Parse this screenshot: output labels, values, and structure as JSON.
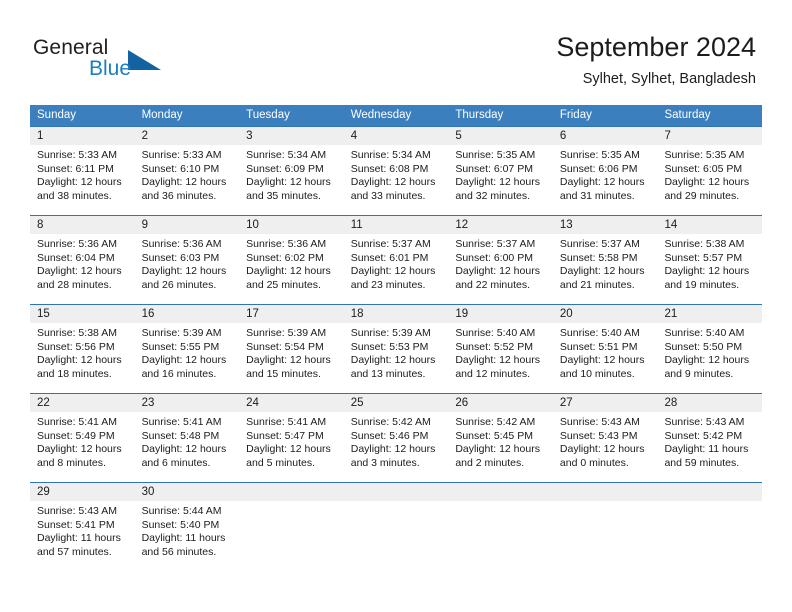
{
  "brand": {
    "name_part1": "General",
    "name_part2": "Blue",
    "flag_icon": "blue-flag-icon"
  },
  "header": {
    "title": "September 2024",
    "location": "Sylhet, Sylhet, Bangladesh"
  },
  "colors": {
    "header_blue": "#3c7fbf",
    "rule_blue": "#2f74b5",
    "daynum_band": "#efefef",
    "brand_blue": "#1a7fc1",
    "text": "#1c1c1c"
  },
  "weekdays": [
    "Sunday",
    "Monday",
    "Tuesday",
    "Wednesday",
    "Thursday",
    "Friday",
    "Saturday"
  ],
  "weeks": [
    [
      {
        "day": "1",
        "sunrise": "Sunrise: 5:33 AM",
        "sunset": "Sunset: 6:11 PM",
        "daylight1": "Daylight: 12 hours",
        "daylight2": "and 38 minutes."
      },
      {
        "day": "2",
        "sunrise": "Sunrise: 5:33 AM",
        "sunset": "Sunset: 6:10 PM",
        "daylight1": "Daylight: 12 hours",
        "daylight2": "and 36 minutes."
      },
      {
        "day": "3",
        "sunrise": "Sunrise: 5:34 AM",
        "sunset": "Sunset: 6:09 PM",
        "daylight1": "Daylight: 12 hours",
        "daylight2": "and 35 minutes."
      },
      {
        "day": "4",
        "sunrise": "Sunrise: 5:34 AM",
        "sunset": "Sunset: 6:08 PM",
        "daylight1": "Daylight: 12 hours",
        "daylight2": "and 33 minutes."
      },
      {
        "day": "5",
        "sunrise": "Sunrise: 5:35 AM",
        "sunset": "Sunset: 6:07 PM",
        "daylight1": "Daylight: 12 hours",
        "daylight2": "and 32 minutes."
      },
      {
        "day": "6",
        "sunrise": "Sunrise: 5:35 AM",
        "sunset": "Sunset: 6:06 PM",
        "daylight1": "Daylight: 12 hours",
        "daylight2": "and 31 minutes."
      },
      {
        "day": "7",
        "sunrise": "Sunrise: 5:35 AM",
        "sunset": "Sunset: 6:05 PM",
        "daylight1": "Daylight: 12 hours",
        "daylight2": "and 29 minutes."
      }
    ],
    [
      {
        "day": "8",
        "sunrise": "Sunrise: 5:36 AM",
        "sunset": "Sunset: 6:04 PM",
        "daylight1": "Daylight: 12 hours",
        "daylight2": "and 28 minutes."
      },
      {
        "day": "9",
        "sunrise": "Sunrise: 5:36 AM",
        "sunset": "Sunset: 6:03 PM",
        "daylight1": "Daylight: 12 hours",
        "daylight2": "and 26 minutes."
      },
      {
        "day": "10",
        "sunrise": "Sunrise: 5:36 AM",
        "sunset": "Sunset: 6:02 PM",
        "daylight1": "Daylight: 12 hours",
        "daylight2": "and 25 minutes."
      },
      {
        "day": "11",
        "sunrise": "Sunrise: 5:37 AM",
        "sunset": "Sunset: 6:01 PM",
        "daylight1": "Daylight: 12 hours",
        "daylight2": "and 23 minutes."
      },
      {
        "day": "12",
        "sunrise": "Sunrise: 5:37 AM",
        "sunset": "Sunset: 6:00 PM",
        "daylight1": "Daylight: 12 hours",
        "daylight2": "and 22 minutes."
      },
      {
        "day": "13",
        "sunrise": "Sunrise: 5:37 AM",
        "sunset": "Sunset: 5:58 PM",
        "daylight1": "Daylight: 12 hours",
        "daylight2": "and 21 minutes."
      },
      {
        "day": "14",
        "sunrise": "Sunrise: 5:38 AM",
        "sunset": "Sunset: 5:57 PM",
        "daylight1": "Daylight: 12 hours",
        "daylight2": "and 19 minutes."
      }
    ],
    [
      {
        "day": "15",
        "sunrise": "Sunrise: 5:38 AM",
        "sunset": "Sunset: 5:56 PM",
        "daylight1": "Daylight: 12 hours",
        "daylight2": "and 18 minutes."
      },
      {
        "day": "16",
        "sunrise": "Sunrise: 5:39 AM",
        "sunset": "Sunset: 5:55 PM",
        "daylight1": "Daylight: 12 hours",
        "daylight2": "and 16 minutes."
      },
      {
        "day": "17",
        "sunrise": "Sunrise: 5:39 AM",
        "sunset": "Sunset: 5:54 PM",
        "daylight1": "Daylight: 12 hours",
        "daylight2": "and 15 minutes."
      },
      {
        "day": "18",
        "sunrise": "Sunrise: 5:39 AM",
        "sunset": "Sunset: 5:53 PM",
        "daylight1": "Daylight: 12 hours",
        "daylight2": "and 13 minutes."
      },
      {
        "day": "19",
        "sunrise": "Sunrise: 5:40 AM",
        "sunset": "Sunset: 5:52 PM",
        "daylight1": "Daylight: 12 hours",
        "daylight2": "and 12 minutes."
      },
      {
        "day": "20",
        "sunrise": "Sunrise: 5:40 AM",
        "sunset": "Sunset: 5:51 PM",
        "daylight1": "Daylight: 12 hours",
        "daylight2": "and 10 minutes."
      },
      {
        "day": "21",
        "sunrise": "Sunrise: 5:40 AM",
        "sunset": "Sunset: 5:50 PM",
        "daylight1": "Daylight: 12 hours",
        "daylight2": "and 9 minutes."
      }
    ],
    [
      {
        "day": "22",
        "sunrise": "Sunrise: 5:41 AM",
        "sunset": "Sunset: 5:49 PM",
        "daylight1": "Daylight: 12 hours",
        "daylight2": "and 8 minutes."
      },
      {
        "day": "23",
        "sunrise": "Sunrise: 5:41 AM",
        "sunset": "Sunset: 5:48 PM",
        "daylight1": "Daylight: 12 hours",
        "daylight2": "and 6 minutes."
      },
      {
        "day": "24",
        "sunrise": "Sunrise: 5:41 AM",
        "sunset": "Sunset: 5:47 PM",
        "daylight1": "Daylight: 12 hours",
        "daylight2": "and 5 minutes."
      },
      {
        "day": "25",
        "sunrise": "Sunrise: 5:42 AM",
        "sunset": "Sunset: 5:46 PM",
        "daylight1": "Daylight: 12 hours",
        "daylight2": "and 3 minutes."
      },
      {
        "day": "26",
        "sunrise": "Sunrise: 5:42 AM",
        "sunset": "Sunset: 5:45 PM",
        "daylight1": "Daylight: 12 hours",
        "daylight2": "and 2 minutes."
      },
      {
        "day": "27",
        "sunrise": "Sunrise: 5:43 AM",
        "sunset": "Sunset: 5:43 PM",
        "daylight1": "Daylight: 12 hours",
        "daylight2": "and 0 minutes."
      },
      {
        "day": "28",
        "sunrise": "Sunrise: 5:43 AM",
        "sunset": "Sunset: 5:42 PM",
        "daylight1": "Daylight: 11 hours",
        "daylight2": "and 59 minutes."
      }
    ],
    [
      {
        "day": "29",
        "sunrise": "Sunrise: 5:43 AM",
        "sunset": "Sunset: 5:41 PM",
        "daylight1": "Daylight: 11 hours",
        "daylight2": "and 57 minutes."
      },
      {
        "day": "30",
        "sunrise": "Sunrise: 5:44 AM",
        "sunset": "Sunset: 5:40 PM",
        "daylight1": "Daylight: 11 hours",
        "daylight2": "and 56 minutes."
      },
      {
        "day": "",
        "sunrise": "",
        "sunset": "",
        "daylight1": "",
        "daylight2": ""
      },
      {
        "day": "",
        "sunrise": "",
        "sunset": "",
        "daylight1": "",
        "daylight2": ""
      },
      {
        "day": "",
        "sunrise": "",
        "sunset": "",
        "daylight1": "",
        "daylight2": ""
      },
      {
        "day": "",
        "sunrise": "",
        "sunset": "",
        "daylight1": "",
        "daylight2": ""
      },
      {
        "day": "",
        "sunrise": "",
        "sunset": "",
        "daylight1": "",
        "daylight2": ""
      }
    ]
  ]
}
